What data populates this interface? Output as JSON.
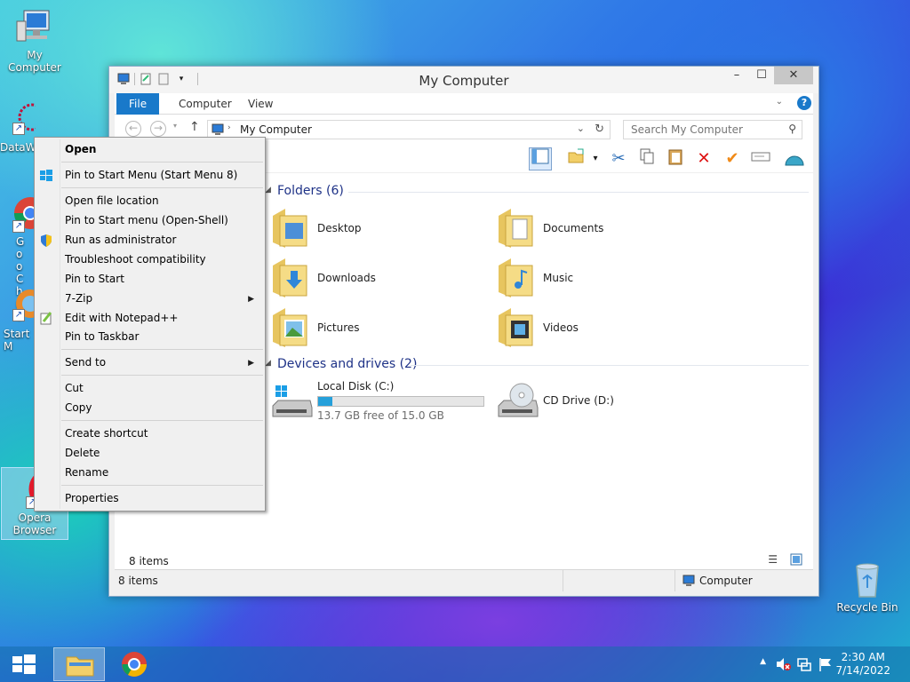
{
  "desktop": {
    "icons": [
      {
        "label": "My Computer"
      },
      {
        "label": "DataW"
      },
      {
        "label": "Goo Chro"
      },
      {
        "label": "Start M"
      },
      {
        "label": "Opera Browser"
      },
      {
        "label": "Recycle Bin"
      }
    ]
  },
  "window": {
    "title": "My Computer",
    "tabs": [
      "File",
      "Computer",
      "View"
    ],
    "address": "My Computer",
    "search_placeholder": "Search My Computer",
    "groups": {
      "folders": "Folders (6)",
      "devices": "Devices and drives (2)"
    },
    "folders": [
      "Desktop",
      "Documents",
      "Downloads",
      "Music",
      "Pictures",
      "Videos"
    ],
    "drives": [
      {
        "name": "Local Disk (C:)",
        "free": "13.7 GB free of 15.0 GB",
        "used_fraction": 0.087
      },
      {
        "name": "CD Drive (D:)"
      }
    ],
    "items_count_inner": "8 items",
    "status_left": "8 items",
    "status_right": "Computer"
  },
  "context_menu": {
    "items": [
      "Open",
      "Pin to Start Menu (Start Menu 8)",
      "Open file location",
      "Pin to Start menu (Open-Shell)",
      "Run as administrator",
      "Troubleshoot compatibility",
      "Pin to Start",
      "7-Zip",
      "Edit with Notepad++",
      "Pin to Taskbar",
      "Send to",
      "Cut",
      "Copy",
      "Create shortcut",
      "Delete",
      "Rename",
      "Properties"
    ]
  },
  "taskbar": {
    "time": "2:30 AM",
    "date": "7/14/2022"
  },
  "colors": {
    "accent": "#1979ca",
    "drive_fill": "#26a0da"
  }
}
